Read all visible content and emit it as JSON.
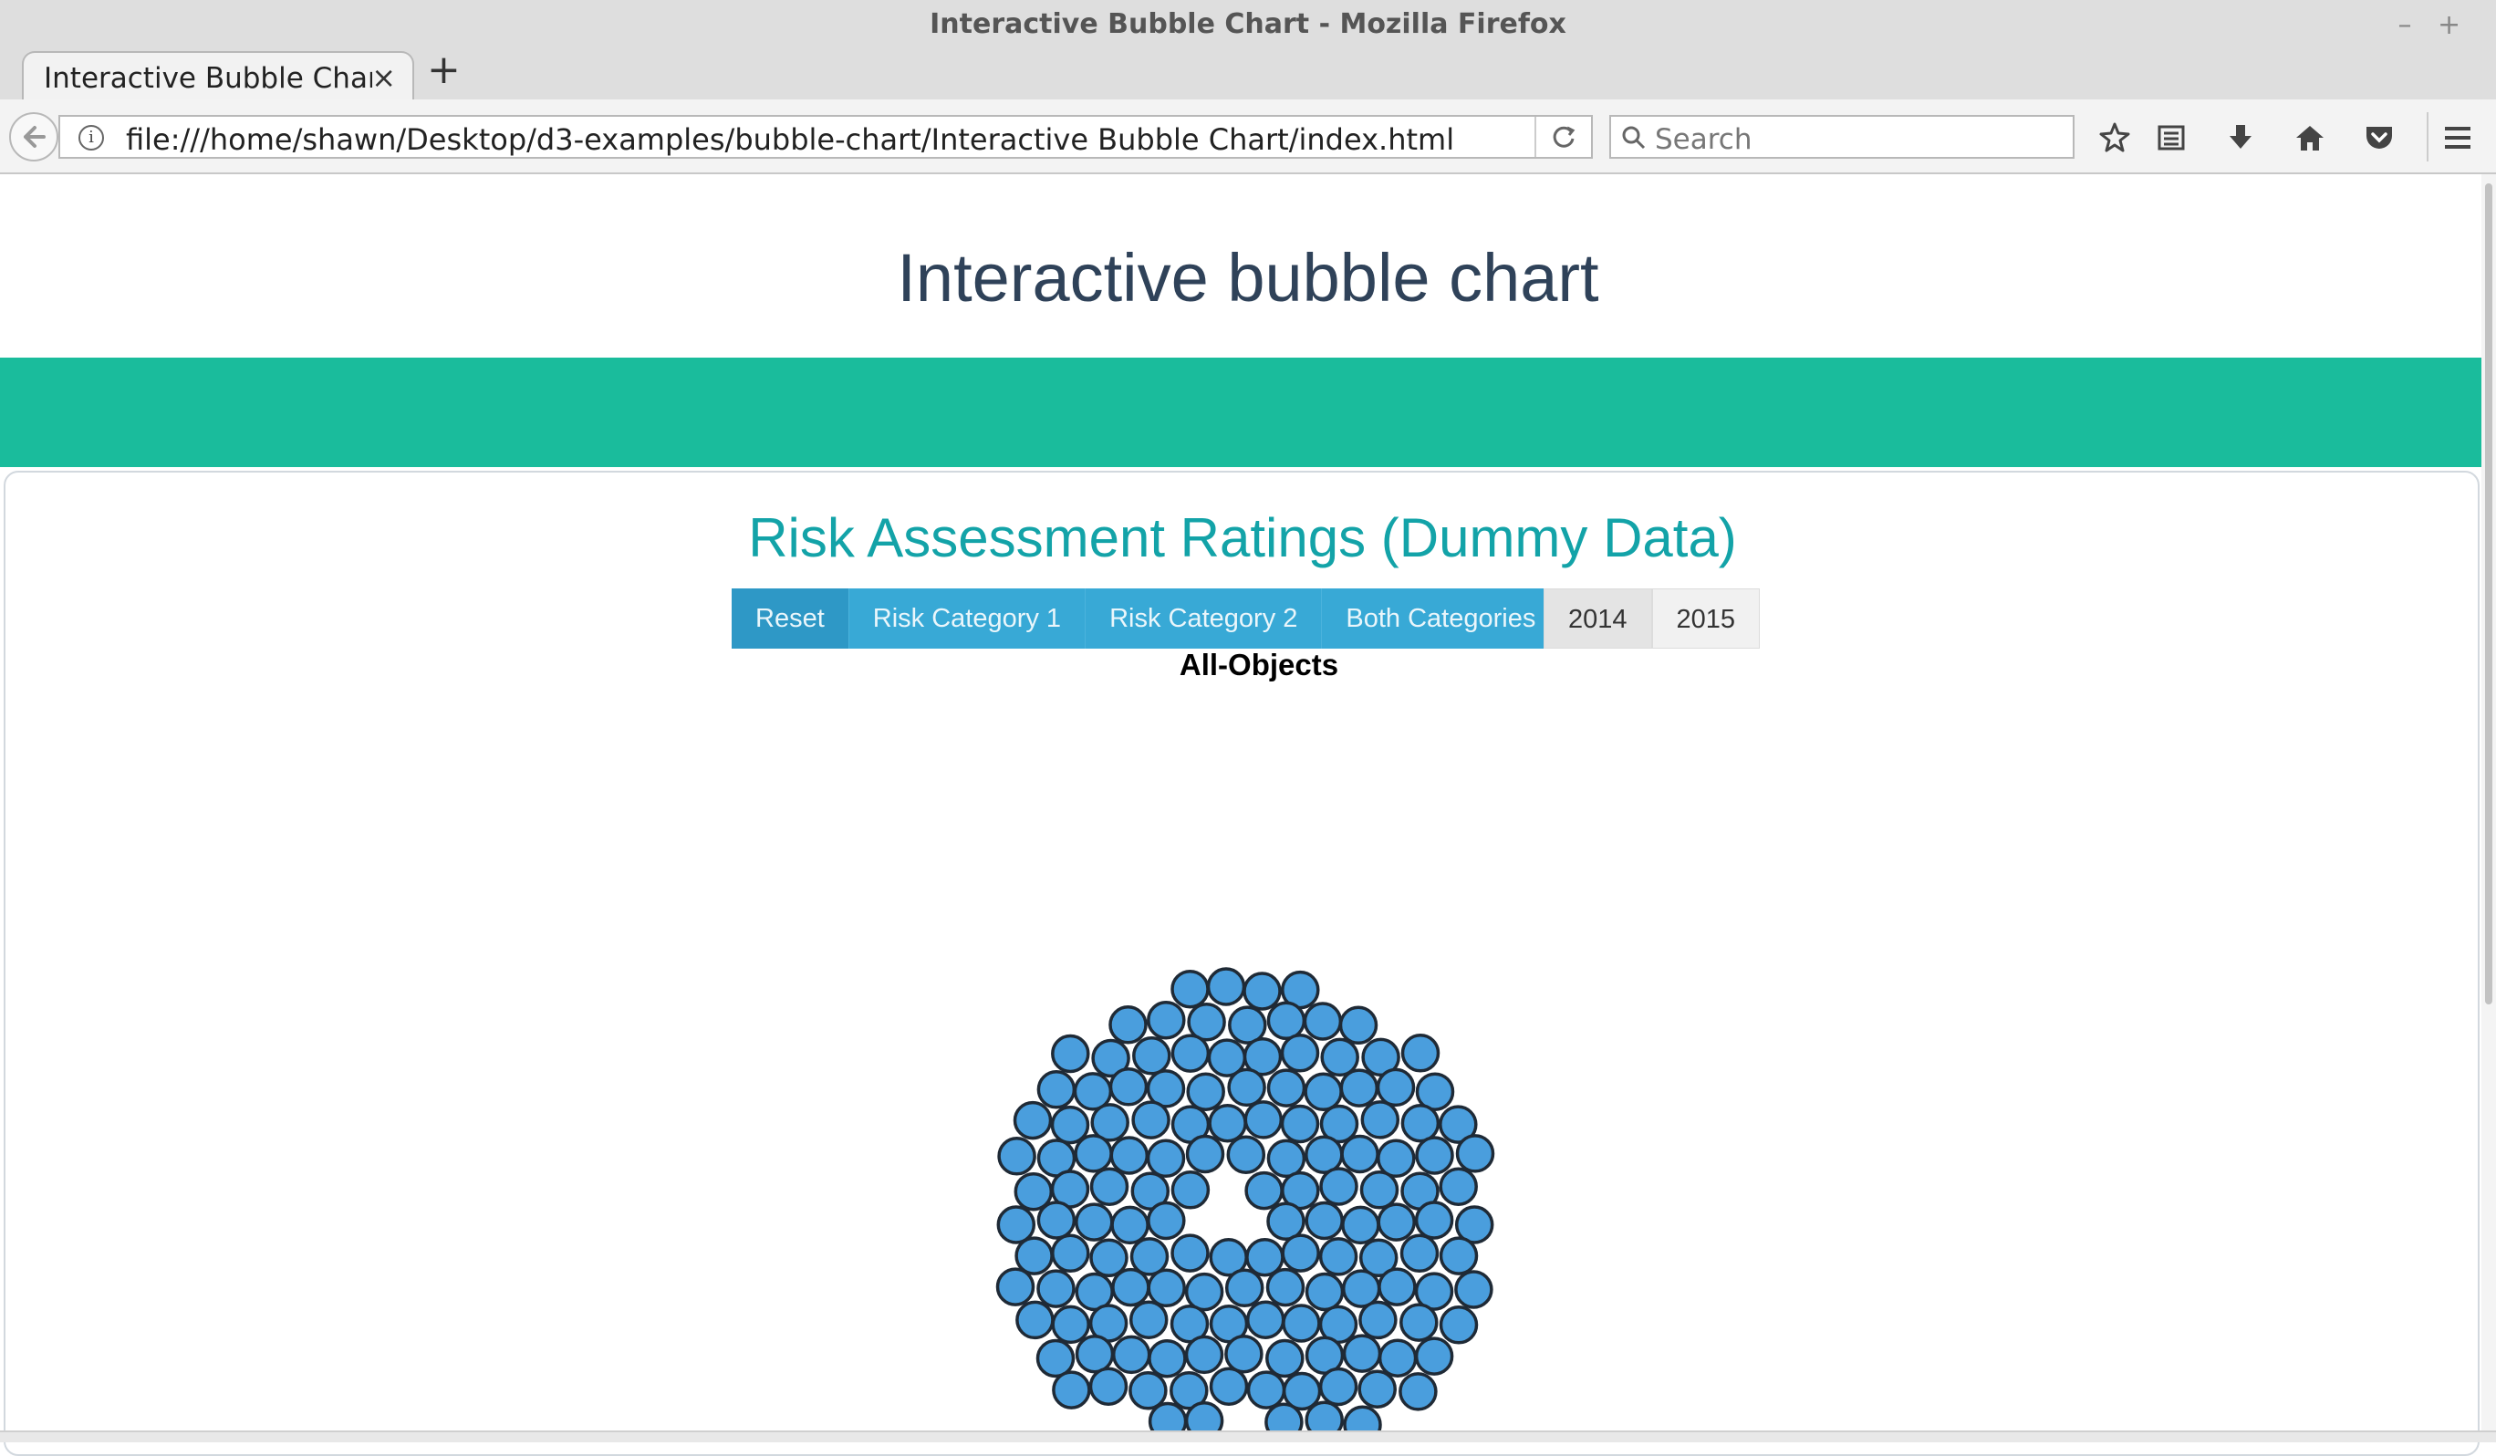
{
  "window": {
    "title": "Interactive Bubble Chart - Mozilla Firefox",
    "controls": [
      "–",
      "+",
      "×"
    ]
  },
  "tabs": [
    {
      "label": "Interactive Bubble Chart",
      "close_icon": "×"
    }
  ],
  "new_tab_icon": "+",
  "navbar": {
    "url": "file:///home/shawn/Desktop/d3-examples/bubble-chart/Interactive Bubble Chart/index.html",
    "search_placeholder": "Search",
    "info_icon": "i"
  },
  "page": {
    "title": "Interactive bubble chart",
    "band_color": "#1abc9c",
    "chart_title": "Risk Assessment Ratings (Dummy Data)",
    "buttons_primary": [
      "Reset",
      "Risk Category 1",
      "Risk Category 2",
      "Both Categories"
    ],
    "buttons_year": [
      "2014",
      "2015"
    ],
    "subtitle": "All-Objects"
  },
  "chart_data": {
    "type": "scatter",
    "title": "All-Objects",
    "series": [
      {
        "values": []
      }
    ],
    "bubble_fill": "#4a9edd",
    "bubble_stroke": "#1f2a36",
    "note_count": 170
  }
}
